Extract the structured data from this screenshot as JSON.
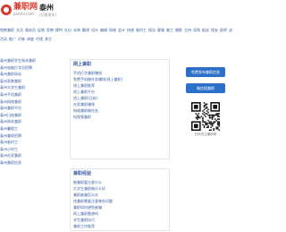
{
  "header": {
    "logo_text": "兼职网",
    "logo_sub": "jianzhi.com",
    "city_name": "泰州",
    "city_switch": "[切换城市]"
  },
  "category_nav": {
    "row1": [
      "销售兼职",
      "文员",
      "服务员",
      "促销",
      "家教",
      "模特",
      "礼仪",
      "派单",
      "翻译",
      "设计",
      "编辑",
      "网络",
      "会计",
      "快递",
      "临时工",
      "保洁",
      "客服",
      "美工",
      "摄影",
      "主持",
      "导购",
      "配送",
      "保安",
      "厨师",
      "送餐",
      "护理",
      "演员",
      "助理",
      "司机"
    ],
    "row2": [
      "活动",
      "推广",
      "问卷",
      "调查",
      "代理",
      "其它"
    ]
  },
  "left_list": {
    "items": [
      "泰州兼职学生周末兼职",
      "泰州电脑打字员招聘",
      "泰州兼职网站",
      "泰州家教兼职",
      "泰州大学生兼职",
      "泰州手机兼职",
      "泰州网络兼职",
      "泰州兼职平台",
      "泰州日结兼职",
      "泰州周末兼职",
      "泰州暑假工",
      "泰州兼职招聘",
      "泰州临时工",
      "泰州小时工",
      "泰州在家兼职",
      "泰州兼职信息"
    ]
  },
  "panel1": {
    "title": "网上兼职",
    "items": [
      "手机打字兼职赚钱",
      "免费手机做任务赚钱(线上兼职)",
      "线上兼职推荐",
      "线上兼职平台",
      "线上兼职(日结)",
      "在家兼职赚钱",
      "网络兼职做任务",
      "短视频兼职"
    ]
  },
  "panel2": {
    "title": "兼职经验",
    "items": [
      "做兼职要注意什么",
      "大学生兼职做什么好",
      "兼职被骗怎么办",
      "找兼职需要注意哪些问题",
      "兼职如何避免被骗",
      "网上兼职靠谱吗",
      "学生兼职技巧",
      "兼职工作推荐"
    ]
  },
  "right_col": {
    "primary_button": "免费发布兼职信息",
    "secondary_button": "微信搜兼职",
    "qr_caption": "扫码关注兼职网"
  },
  "colors": {
    "brand_red": "#d83a2e",
    "link_blue": "#3a5fa0",
    "button_blue": "#2b6fc8"
  }
}
